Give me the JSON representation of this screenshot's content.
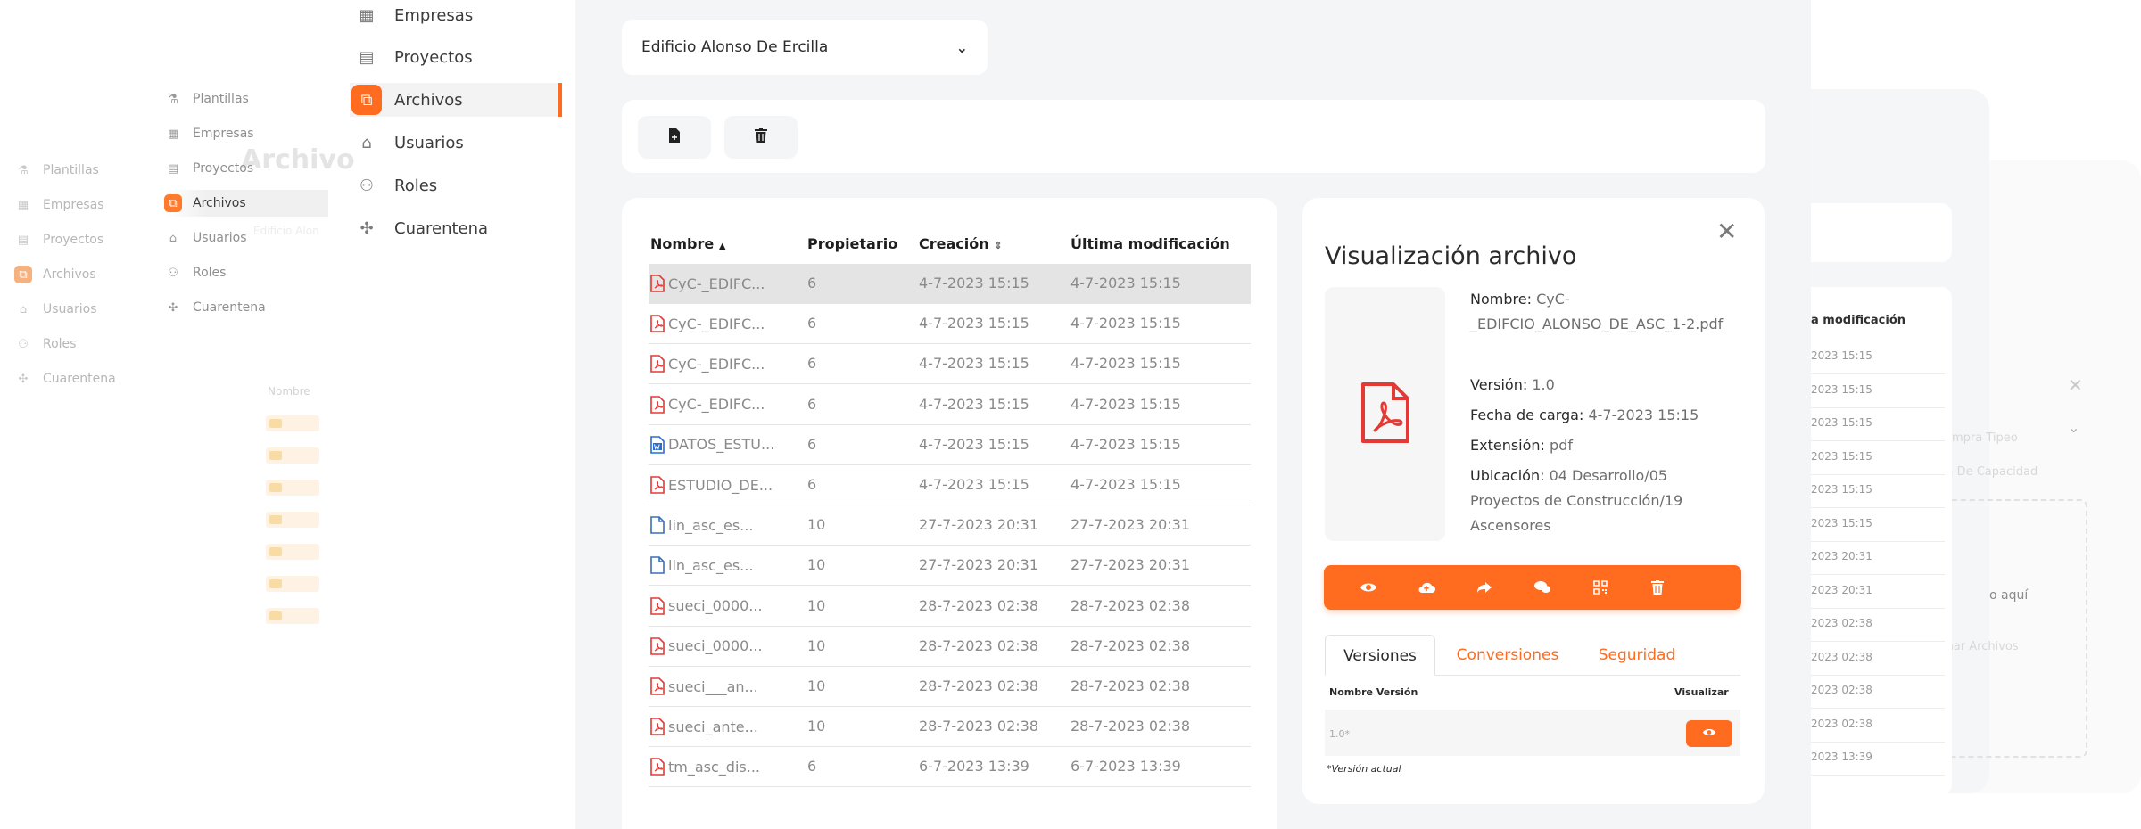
{
  "ghost_far_nav": {
    "items": [
      {
        "label": "Plantillas",
        "icon": "templates-icon"
      },
      {
        "label": "Empresas",
        "icon": "building-icon"
      },
      {
        "label": "Proyectos",
        "icon": "projects-icon"
      },
      {
        "label": "Archivos",
        "icon": "files-icon",
        "active": true
      },
      {
        "label": "Usuarios",
        "icon": "home-icon"
      },
      {
        "label": "Roles",
        "icon": "roles-icon"
      },
      {
        "label": "Cuarentena",
        "icon": "quarantine-icon"
      }
    ]
  },
  "ghost_mid_nav": {
    "items": [
      {
        "label": "Plantillas"
      },
      {
        "label": "Empresas"
      },
      {
        "label": "Proyectos"
      },
      {
        "label": "Archivos",
        "active": true
      },
      {
        "label": "Usuarios"
      },
      {
        "label": "Roles"
      },
      {
        "label": "Cuarentena"
      }
    ],
    "bg_title": "Archivo",
    "bg_project": "Edificio Alon",
    "bg_col_header": "Nombre"
  },
  "nav": {
    "items": [
      {
        "label": "Empresas",
        "icon": "building-icon"
      },
      {
        "label": "Proyectos",
        "icon": "projects-icon"
      },
      {
        "label": "Archivos",
        "icon": "files-icon",
        "active": true
      },
      {
        "label": "Usuarios",
        "icon": "home-icon"
      },
      {
        "label": "Roles",
        "icon": "roles-icon"
      },
      {
        "label": "Cuarentena",
        "icon": "quarantine-icon"
      }
    ]
  },
  "project_select": {
    "value": "Edificio Alonso De Ercilla"
  },
  "table": {
    "columns": [
      "Nombre",
      "Propietario",
      "Creación",
      "Última modificación"
    ],
    "rows": [
      {
        "name": "CyC-_EDIFC...",
        "owner": "6",
        "created": "4-7-2023 15:15",
        "modified": "4-7-2023 15:15",
        "type": "pdf",
        "selected": true
      },
      {
        "name": "CyC-_EDIFC...",
        "owner": "6",
        "created": "4-7-2023 15:15",
        "modified": "4-7-2023 15:15",
        "type": "pdf"
      },
      {
        "name": "CyC-_EDIFC...",
        "owner": "6",
        "created": "4-7-2023 15:15",
        "modified": "4-7-2023 15:15",
        "type": "pdf"
      },
      {
        "name": "CyC-_EDIFC...",
        "owner": "6",
        "created": "4-7-2023 15:15",
        "modified": "4-7-2023 15:15",
        "type": "pdf"
      },
      {
        "name": "DATOS_ESTU...",
        "owner": "6",
        "created": "4-7-2023 15:15",
        "modified": "4-7-2023 15:15",
        "type": "word"
      },
      {
        "name": "ESTUDIO_DE...",
        "owner": "6",
        "created": "4-7-2023 15:15",
        "modified": "4-7-2023 15:15",
        "type": "pdf"
      },
      {
        "name": "lin_asc_es...",
        "owner": "10",
        "created": "27-7-2023 20:31",
        "modified": "27-7-2023 20:31",
        "type": "file"
      },
      {
        "name": "lin_asc_es...",
        "owner": "10",
        "created": "27-7-2023 20:31",
        "modified": "27-7-2023 20:31",
        "type": "file"
      },
      {
        "name": "sueci_0000...",
        "owner": "10",
        "created": "28-7-2023 02:38",
        "modified": "28-7-2023 02:38",
        "type": "pdf"
      },
      {
        "name": "sueci_0000...",
        "owner": "10",
        "created": "28-7-2023 02:38",
        "modified": "28-7-2023 02:38",
        "type": "pdf"
      },
      {
        "name": "sueci___an...",
        "owner": "10",
        "created": "28-7-2023 02:38",
        "modified": "28-7-2023 02:38",
        "type": "pdf"
      },
      {
        "name": "sueci_ante...",
        "owner": "10",
        "created": "28-7-2023 02:38",
        "modified": "28-7-2023 02:38",
        "type": "pdf"
      },
      {
        "name": "tm_asc_dis...",
        "owner": "6",
        "created": "6-7-2023 13:39",
        "modified": "6-7-2023 13:39",
        "type": "pdf"
      }
    ]
  },
  "detail": {
    "title": "Visualización archivo",
    "name_label": "Nombre:",
    "name_value": "CyC-_EDIFCIO_ALONSO_DE_ASC_1-2.pdf",
    "version_label": "Versión:",
    "version_value": "1.0",
    "date_label": "Fecha de carga:",
    "date_value": "4-7-2023 15:15",
    "ext_label": "Extensión:",
    "ext_value": "pdf",
    "location_label": "Ubicación:",
    "location_value": "04 Desarrollo/05 Proyectos de Construcción/19 Ascensores",
    "tabs": [
      "Versiones",
      "Conversiones",
      "Seguridad"
    ],
    "versions_header_name": "Nombre Versión",
    "versions_header_view": "Visualizar",
    "versions": [
      {
        "name": "1.0*"
      }
    ],
    "version_note": "*Versión actual"
  },
  "ghost_right": {
    "col_header": "a modificación",
    "rows": [
      "2023 15:15",
      "2023 15:15",
      "2023 15:15",
      "2023 15:15",
      "2023 15:15",
      "2023 15:15",
      "2023 20:31",
      "2023 20:31",
      "2023 02:38",
      "2023 02:38",
      "2023 02:38",
      "2023 02:38",
      "2023 13:39"
    ],
    "faded_1": "ompra Tipeo",
    "faded_2": "Falla De Capacidad",
    "faded_3": "o aquí",
    "faded_4": "ionar Archivos"
  },
  "colors": {
    "accent": "#ff6b1f",
    "pdf_red": "#e53935",
    "word_blue": "#2b6cd6",
    "panel_bg": "#f4f5f7"
  }
}
